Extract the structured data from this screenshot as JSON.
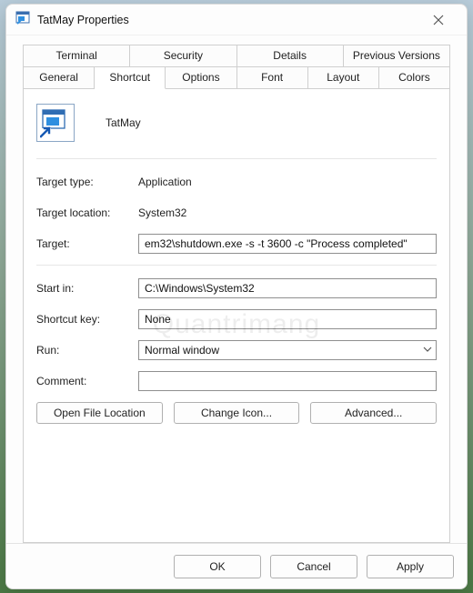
{
  "window": {
    "title": "TatMay Properties"
  },
  "tabs_row1": [
    {
      "label": "Terminal"
    },
    {
      "label": "Security"
    },
    {
      "label": "Details"
    },
    {
      "label": "Previous Versions"
    }
  ],
  "tabs_row2": [
    {
      "label": "General"
    },
    {
      "label": "Shortcut",
      "active": true
    },
    {
      "label": "Options"
    },
    {
      "label": "Font"
    },
    {
      "label": "Layout"
    },
    {
      "label": "Colors"
    }
  ],
  "shortcut": {
    "name": "TatMay",
    "target_type_label": "Target type:",
    "target_type_value": "Application",
    "target_location_label": "Target location:",
    "target_location_value": "System32",
    "target_label": "Target:",
    "target_value": "em32\\shutdown.exe -s -t 3600 -c \"Process completed\"",
    "start_in_label": "Start in:",
    "start_in_value": "C:\\Windows\\System32",
    "shortcut_key_label": "Shortcut key:",
    "shortcut_key_value": "None",
    "run_label": "Run:",
    "run_value": "Normal window",
    "comment_label": "Comment:",
    "comment_value": ""
  },
  "buttons": {
    "open_file_location": "Open File Location",
    "change_icon": "Change Icon...",
    "advanced": "Advanced..."
  },
  "footer": {
    "ok": "OK",
    "cancel": "Cancel",
    "apply": "Apply"
  },
  "watermark": "Quantrimang"
}
